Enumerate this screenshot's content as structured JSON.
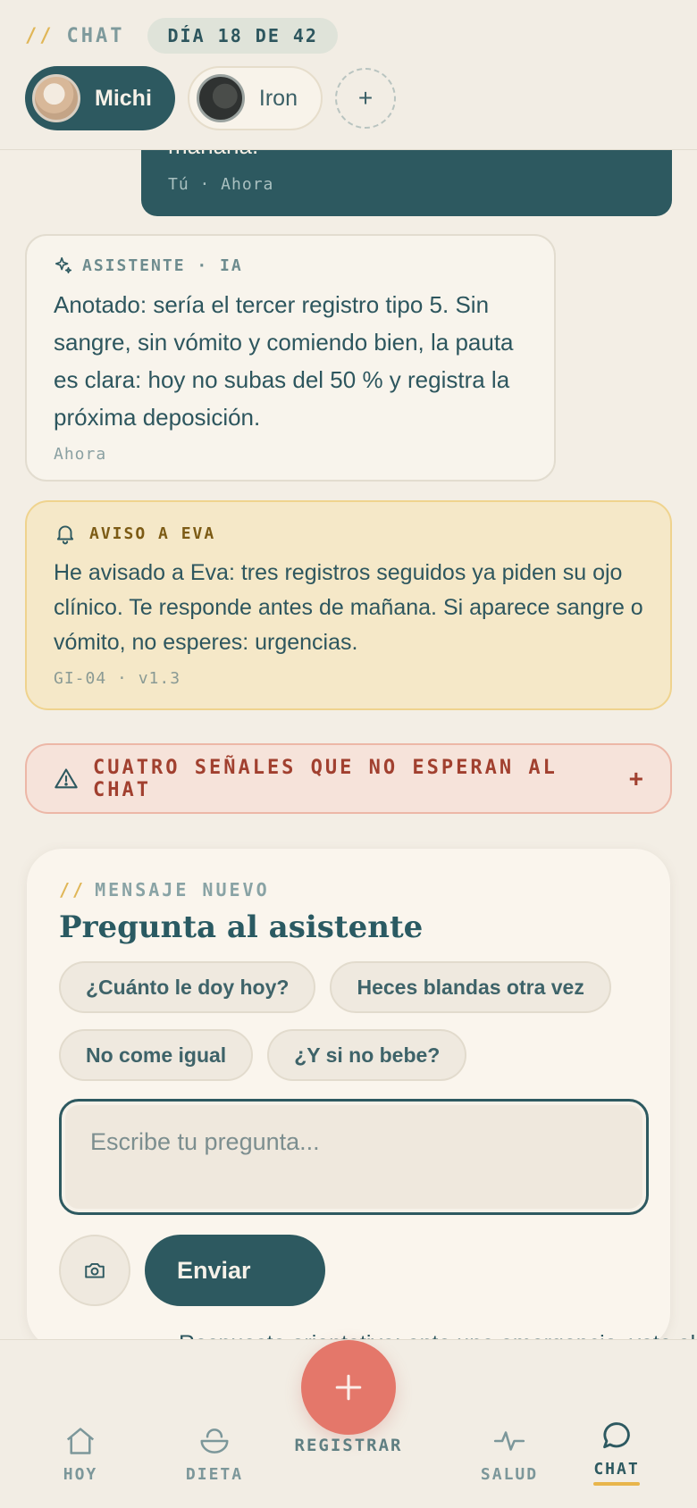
{
  "header": {
    "section_slashes": "//",
    "section_label": "CHAT",
    "day_badge": "DÍA 18 DE 42",
    "pets": [
      {
        "name": "Michi",
        "active": true
      },
      {
        "name": "Iron",
        "active": false
      }
    ],
    "add_pet_label": "+"
  },
  "user_message": {
    "text": "mañana.",
    "meta": "Tú · Ahora"
  },
  "assistant_message": {
    "label": "ASISTENTE · IA",
    "text": "Anotado: sería el tercer registro tipo 5. Sin sangre, sin vómito y comiendo bien, la pauta es clara: hoy no subas del 50 % y registra la próxima deposición.",
    "time": "Ahora"
  },
  "notice": {
    "label": "AVISO A EVA",
    "text": "He avisado a Eva: tres registros seguidos ya piden su ojo clínico. Te responde antes de mañana. Si aparece sangre o vómito, no esperes: urgencias.",
    "meta": "GI-04 · v1.3"
  },
  "warning": {
    "label": "CUATRO SEÑALES QUE NO ESPERAN AL CHAT",
    "toggle": "+"
  },
  "composer": {
    "kicker_slashes": "//",
    "kicker": "MENSAJE NUEVO",
    "title": "Pregunta al asistente",
    "chips": [
      "¿Cuánto le doy hoy?",
      "Heces blandas otra vez",
      "No come igual",
      "¿Y si no bebe?"
    ],
    "input_placeholder": "Escribe tu pregunta...",
    "send_label": "Enviar",
    "peek_text": "Respuesta orientativa: ante una emergencia, vete al"
  },
  "nav": {
    "items": [
      {
        "label": "HOY",
        "icon": "home-icon"
      },
      {
        "label": "DIETA",
        "icon": "bowl-icon"
      },
      {
        "label": "REGISTRAR",
        "icon": "plus-icon"
      },
      {
        "label": "SALUD",
        "icon": "pulse-icon"
      },
      {
        "label": "CHAT",
        "icon": "chat-bubble-icon",
        "active": true
      }
    ]
  },
  "colors": {
    "primary": "#2d5960",
    "accent_yellow": "#e8b54b",
    "fab": "#e4776a",
    "notice_bg": "#f5e8c8",
    "warning_text": "#a1402f"
  }
}
